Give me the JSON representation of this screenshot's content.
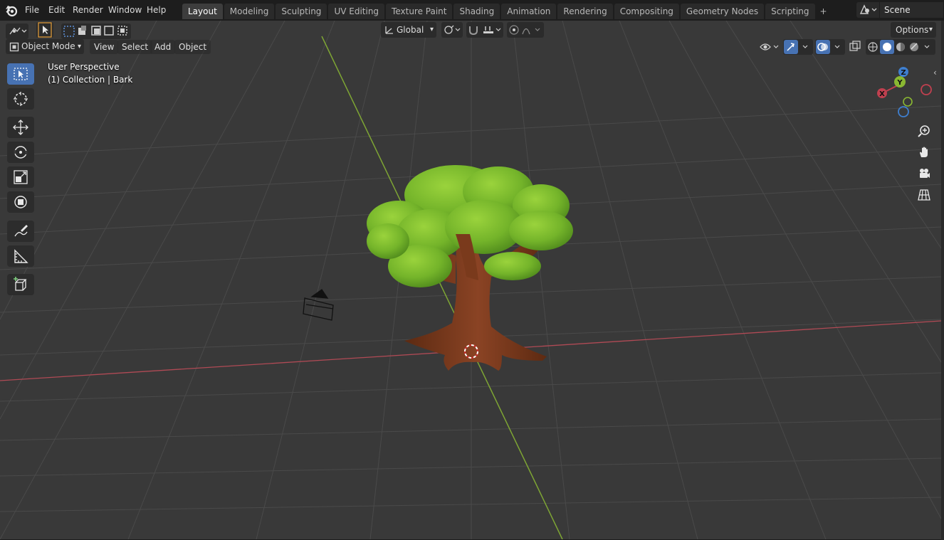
{
  "menu": {
    "items": [
      "File",
      "Edit",
      "Render",
      "Window",
      "Help"
    ]
  },
  "workspaces": {
    "tabs": [
      "Layout",
      "Modeling",
      "Sculpting",
      "UV Editing",
      "Texture Paint",
      "Shading",
      "Animation",
      "Rendering",
      "Compositing",
      "Geometry Nodes",
      "Scripting"
    ],
    "active": "Layout",
    "add_symbol": "+"
  },
  "scene": {
    "name": "Scene"
  },
  "tool_header": {
    "orientation": "Global",
    "options_label": "Options"
  },
  "viewport_header": {
    "mode": "Object Mode",
    "menus": [
      "View",
      "Select",
      "Add",
      "Object"
    ]
  },
  "overlay": {
    "perspective": "User Perspective",
    "collection": "(1) Collection | Bark"
  },
  "gizmo": {
    "x_label": "X",
    "y_label": "Y",
    "z_label": "Z"
  },
  "toolbar": {
    "tools": [
      "select-box",
      "cursor",
      "move",
      "rotate",
      "scale",
      "transform",
      "annotate",
      "measure",
      "add-cube"
    ],
    "active": "select-box"
  },
  "colors": {
    "accent": "#4772b3",
    "x_axis": "#c0404f",
    "y_axis": "#8ab832",
    "z_axis": "#3f7fcf",
    "canopy": "#7cbd2e",
    "trunk": "#7a3a1c",
    "grid_bg": "#393939"
  }
}
